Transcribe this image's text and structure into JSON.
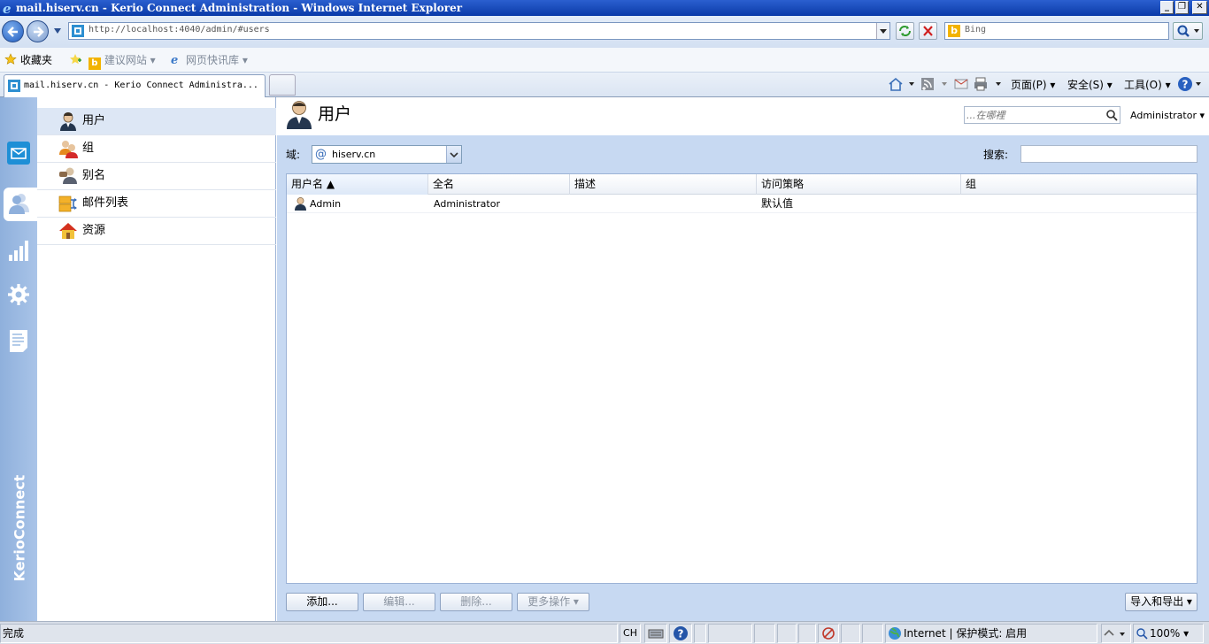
{
  "window": {
    "title": "mail.hiserv.cn - Kerio Connect Administration - Windows Internet Explorer",
    "min_glyph": "_",
    "max_glyph": "❐",
    "close_glyph": "✕"
  },
  "browser": {
    "url": "http://localhost:4040/admin/#users",
    "search_provider": "Bing",
    "favorites_label": "收藏夹",
    "fav_links": [
      "建议网站 ▾",
      "网页快讯库 ▾"
    ],
    "tab_title": "mail.hiserv.cn - Kerio Connect Administra...",
    "commands": [
      "页面(P) ▾",
      "安全(S) ▾",
      "工具(O) ▾"
    ]
  },
  "app": {
    "brand": "KerioConnect",
    "rail": [
      {
        "icon": "mail-icon",
        "color": "#1e8fd6"
      },
      {
        "icon": "users-icon",
        "color": "#8fb0dc"
      },
      {
        "icon": "statistics-icon",
        "color": "#ffffff"
      },
      {
        "icon": "settings-gear-icon",
        "color": "#ffffff"
      },
      {
        "icon": "logs-icon",
        "color": "#ffffff"
      }
    ],
    "sidebar": [
      {
        "label": "用户",
        "icon": "user-icon",
        "selected": true
      },
      {
        "label": "组",
        "icon": "group-icon",
        "selected": false
      },
      {
        "label": "别名",
        "icon": "alias-icon",
        "selected": false
      },
      {
        "label": "邮件列表",
        "icon": "mailing-list-icon",
        "selected": false
      },
      {
        "label": "资源",
        "icon": "resource-house-icon",
        "selected": false
      }
    ],
    "page_title": "用户",
    "quick_search_placeholder": "...在哪裡",
    "admin_menu": "Administrator ▾",
    "domain_label": "域:",
    "domain_value": "hiserv.cn",
    "search_label": "搜索:",
    "table": {
      "columns": [
        "用户名 ▲",
        "全名",
        "描述",
        "访问策略",
        "组"
      ],
      "rows": [
        {
          "username": "Admin",
          "fullname": "Administrator",
          "description": "",
          "policy": "默认值",
          "group": ""
        }
      ]
    },
    "buttons": {
      "add": "添加...",
      "edit": "编辑...",
      "delete": "删除...",
      "more": "更多操作 ▾",
      "import_export": "导入和导出 ▾"
    }
  },
  "statusbar": {
    "text": "完成",
    "ime": "CH",
    "zone": "Internet | 保护模式: 启用",
    "zoom": "100% ▾"
  }
}
